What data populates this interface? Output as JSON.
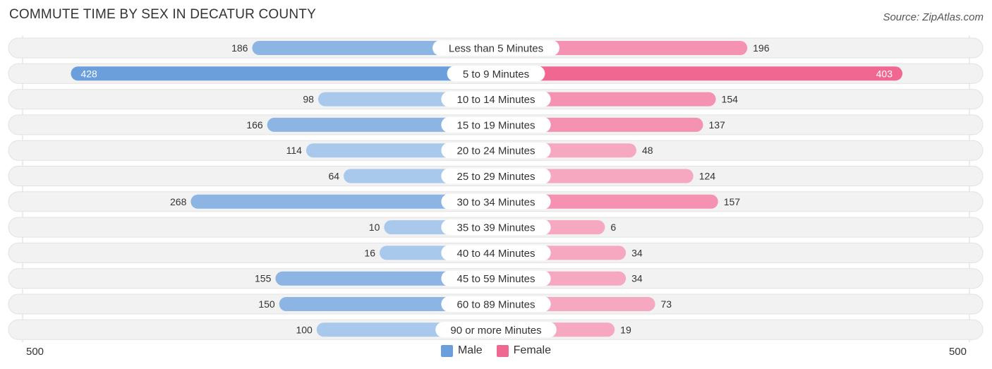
{
  "title": "COMMUTE TIME BY SEX IN DECATUR COUNTY",
  "source": "Source: ZipAtlas.com",
  "colors": {
    "male": "#6a9fdc",
    "male_light": "#a9c9ec",
    "female": "#f06892",
    "female_light": "#f7a8c1",
    "row_bg": "#f2f2f2"
  },
  "legend": [
    {
      "label": "Male",
      "color": "#6a9fdc"
    },
    {
      "label": "Female",
      "color": "#f06892"
    }
  ],
  "axis": {
    "left_label": "500",
    "right_label": "500"
  },
  "chart_data": {
    "type": "bar",
    "orientation": "horizontal-diverging",
    "title": "COMMUTE TIME BY SEX IN DECATUR COUNTY",
    "categories": [
      "Less than 5 Minutes",
      "5 to 9 Minutes",
      "10 to 14 Minutes",
      "15 to 19 Minutes",
      "20 to 24 Minutes",
      "25 to 29 Minutes",
      "30 to 34 Minutes",
      "35 to 39 Minutes",
      "40 to 44 Minutes",
      "45 to 59 Minutes",
      "60 to 89 Minutes",
      "90 or more Minutes"
    ],
    "series": [
      {
        "name": "Male",
        "values": [
          186,
          428,
          98,
          166,
          114,
          64,
          268,
          10,
          16,
          155,
          150,
          100
        ]
      },
      {
        "name": "Female",
        "values": [
          196,
          403,
          154,
          137,
          48,
          124,
          157,
          6,
          34,
          34,
          73,
          19
        ]
      }
    ],
    "xlim": [
      500,
      500
    ],
    "legend_position": "bottom-center"
  }
}
